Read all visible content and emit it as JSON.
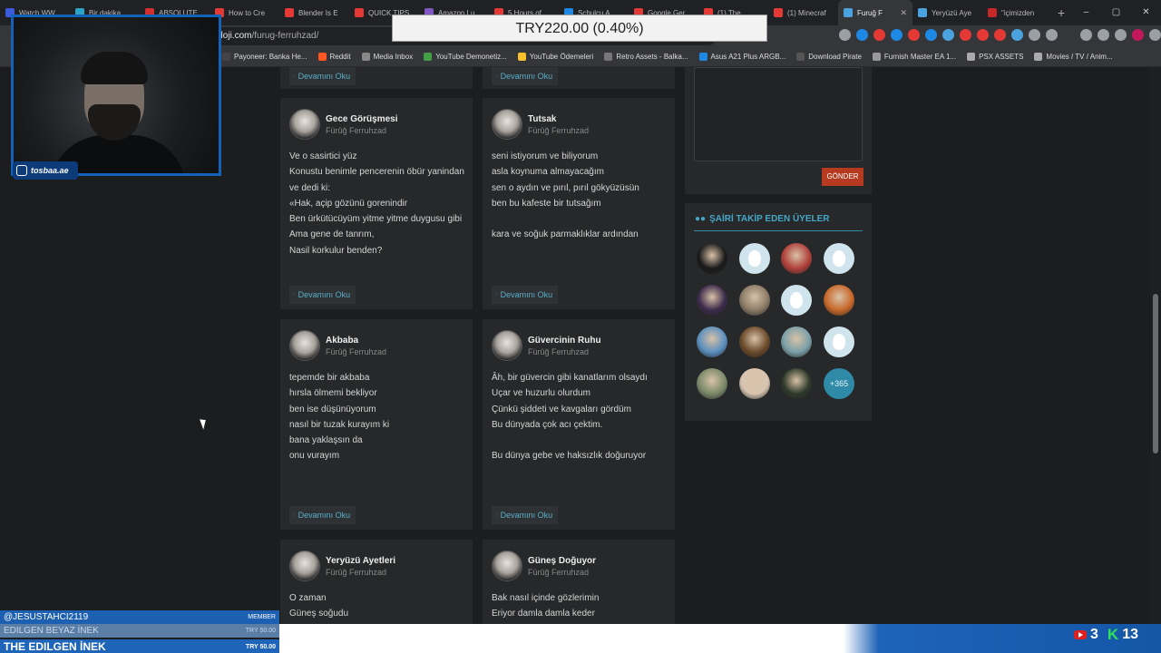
{
  "browser": {
    "tabs": [
      {
        "label": "Watch WW",
        "color": "#3b5bdb"
      },
      {
        "label": "Bir dakika",
        "color": "#2aa4c8"
      },
      {
        "label": "ABSOLUTE",
        "color": "#d32f2f"
      },
      {
        "label": "How to Cre",
        "color": "#e53935"
      },
      {
        "label": "Blender Is E",
        "color": "#e53935"
      },
      {
        "label": "QUICK TIPS",
        "color": "#e53935"
      },
      {
        "label": "Amazon Lu",
        "color": "#7e57c2"
      },
      {
        "label": "5 Hours of",
        "color": "#e53935"
      },
      {
        "label": "Schulcu A",
        "color": "#1e88e5"
      },
      {
        "label": "Google Ger",
        "color": "#e53935"
      },
      {
        "label": "(1) The",
        "color": "#e53935"
      },
      {
        "label": "(1) Minecraf",
        "color": "#e53935"
      },
      {
        "label": "Furuğ F",
        "color": "#4aa3df"
      },
      {
        "label": "Yeryüzü Aye",
        "color": "#4aa3df"
      },
      {
        "label": "\"içimizden",
        "color": "#c62828"
      }
    ],
    "active_tab_index": 12,
    "address": {
      "domain": "oloji.com",
      "path": "/furug-ferruhzad/"
    },
    "window_controls": [
      "–",
      "▢",
      "✕"
    ],
    "bookmarks": [
      {
        "label": "Payoneer: Banka He...",
        "color": "#444"
      },
      {
        "label": "Reddit",
        "color": "#ff5722"
      },
      {
        "label": "Media Inbox",
        "color": "#888"
      },
      {
        "label": "YouTube Demonetiz...",
        "color": "#43a047"
      },
      {
        "label": "YouTube Ödemeleri",
        "color": "#fbc02d"
      },
      {
        "label": "Retro Assets - Balka...",
        "color": "#777"
      },
      {
        "label": "Asus A21 Plus ARGB...",
        "color": "#1e88e5"
      },
      {
        "label": "Download Pirate",
        "color": "#555"
      },
      {
        "label": "Furnish Master EA 1...",
        "color": "#999"
      },
      {
        "label": "PSX ASSETS",
        "color": "#aaa"
      },
      {
        "label": "Movies / TV / Anim...",
        "color": "#aaa"
      }
    ]
  },
  "donation": {
    "text": "TRY220.00 (0.40%)"
  },
  "webcam": {
    "instagram_handle": "tosbaa.ae"
  },
  "poems": {
    "devamini_oku": "Devamını Oku",
    "author": "Fürûğ Ferruhzad",
    "cards": [
      {
        "title": "Gece Görüşmesi",
        "lines": [
          "Ve o sasirtici yüz",
          "Konustu benimle pencerenin öbür yanindan",
          "ve dedi ki:",
          "«Hak, açip gözünü gorenindir",
          "Ben ürkütücüyüm yitme yitme duygusu gibi",
          "Ama gene de tanrım,",
          "Nasil korkulur benden?"
        ]
      },
      {
        "title": "Tutsak",
        "lines": [
          "seni istiyorum ve biliyorum",
          "asla koynuma almayacağım",
          "sen o aydın ve pırıl, pırıl gökyüzüsün",
          "ben bu kafeste bir tutsağım",
          "",
          "kara ve soğuk parmaklıklar ardından"
        ]
      },
      {
        "title": "Akbaba",
        "lines": [
          "tepemde bir akbaba",
          "hırsla ölmemi bekliyor",
          "ben ise düşünüyorum",
          "nasıl bir tuzak kurayım ki",
          "bana yaklaşsın da",
          "onu vurayım"
        ]
      },
      {
        "title": "Güvercinin Ruhu",
        "lines": [
          "Âh, bir güvercin gibi kanatlarım olsaydı",
          "Uçar ve huzurlu olurdum",
          "Çünkü şiddeti ve kavgaları gördüm",
          "Bu dünyada çok acı çektim.",
          "",
          "Bu dünya gebe ve haksızlık doğuruyor"
        ]
      },
      {
        "title": "Yeryüzü Ayetleri",
        "lines": [
          "O zaman",
          "Güneş soğudu"
        ]
      },
      {
        "title": "Güneş Doğuyor",
        "lines": [
          "Bak nasıl içinde gözlerimin",
          "Eriyor damla damla keder"
        ]
      }
    ]
  },
  "sidebar": {
    "submit_label": "GÖNDER",
    "followers_title": "ŞAİRİ TAKİP EDEN ÜYELER",
    "followers_more": "+365",
    "avatars": [
      {
        "kind": "photo",
        "color": "#1a1a1a"
      },
      {
        "kind": "owl",
        "color": "#cfe4ec"
      },
      {
        "kind": "photo",
        "color": "#b0403a"
      },
      {
        "kind": "owl",
        "color": "#cfe4ec"
      },
      {
        "kind": "photo",
        "color": "#3b2a4a"
      },
      {
        "kind": "photo",
        "color": "#8a7a66"
      },
      {
        "kind": "owl",
        "color": "#cfe4ec"
      },
      {
        "kind": "photo",
        "color": "#c8682a"
      },
      {
        "kind": "photo",
        "color": "#5b8fbf"
      },
      {
        "kind": "photo",
        "color": "#6a4a2a"
      },
      {
        "kind": "photo",
        "color": "#7aa0a8"
      },
      {
        "kind": "owl",
        "color": "#cfe4ec"
      },
      {
        "kind": "photo",
        "color": "#7a8a6a"
      },
      {
        "kind": "photo",
        "color": "#d8c4b0"
      },
      {
        "kind": "photo",
        "color": "#2e3a2a"
      }
    ]
  },
  "stream_alerts": [
    {
      "name": "@JESUSTAHCI2119",
      "amount": "MEMBER",
      "bg": "#1d5fb0",
      "color": "#ffffff"
    },
    {
      "name": "EDILGEN BEYAZ İNEK",
      "amount": "TRY 50.00",
      "bg": "#5a7ea6",
      "color": "#c9d8ea"
    },
    {
      "name": "THE EDILGEN İNEK",
      "amount": "TRY 50.00",
      "bg": "#1e64b8",
      "color": "#ffffff"
    }
  ],
  "stream_counters": {
    "youtube": "3",
    "kick": "13"
  }
}
